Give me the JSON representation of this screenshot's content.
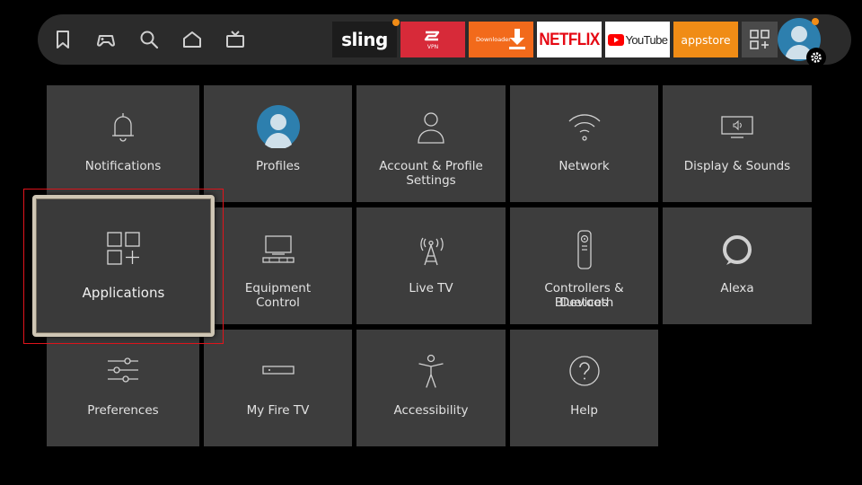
{
  "nav": {
    "icons": [
      "bookmark-icon",
      "gamepad-icon",
      "search-icon",
      "home-icon",
      "live-tv-icon"
    ],
    "apps": [
      {
        "name": "sling-app",
        "label": "sling",
        "color": "#1c1c1c"
      },
      {
        "name": "vpn-app",
        "label": "VPN",
        "color": "#d72a39"
      },
      {
        "name": "downloader-app",
        "label": "Downloader",
        "color": "#f26a1b"
      },
      {
        "name": "netflix-app",
        "label": "NETFLIX",
        "color": "#ffffff"
      },
      {
        "name": "youtube-app",
        "label": "YouTube",
        "color": "#ffffff"
      },
      {
        "name": "appstore-app",
        "label": "appstore",
        "color": "#f08c16"
      }
    ]
  },
  "tiles": {
    "notifications": "Notifications",
    "profiles": "Profiles",
    "account_l1": "Account & Profile",
    "account_l2": "Settings",
    "network": "Network",
    "display": "Display & Sounds",
    "applications": "Applications",
    "equipment_l1": "Equipment",
    "equipment_l2": "Control",
    "livetv": "Live TV",
    "controllers_l1": "Controllers & Bluetooth",
    "controllers_l2": "Devices",
    "alexa": "Alexa",
    "preferences": "Preferences",
    "myfiretv": "My Fire TV",
    "accessibility": "Accessibility",
    "help": "Help"
  },
  "colors": {
    "accent_orange": "#f08c16",
    "highlight_red": "#e1141c",
    "tile_bg": "#3d3d3d"
  }
}
